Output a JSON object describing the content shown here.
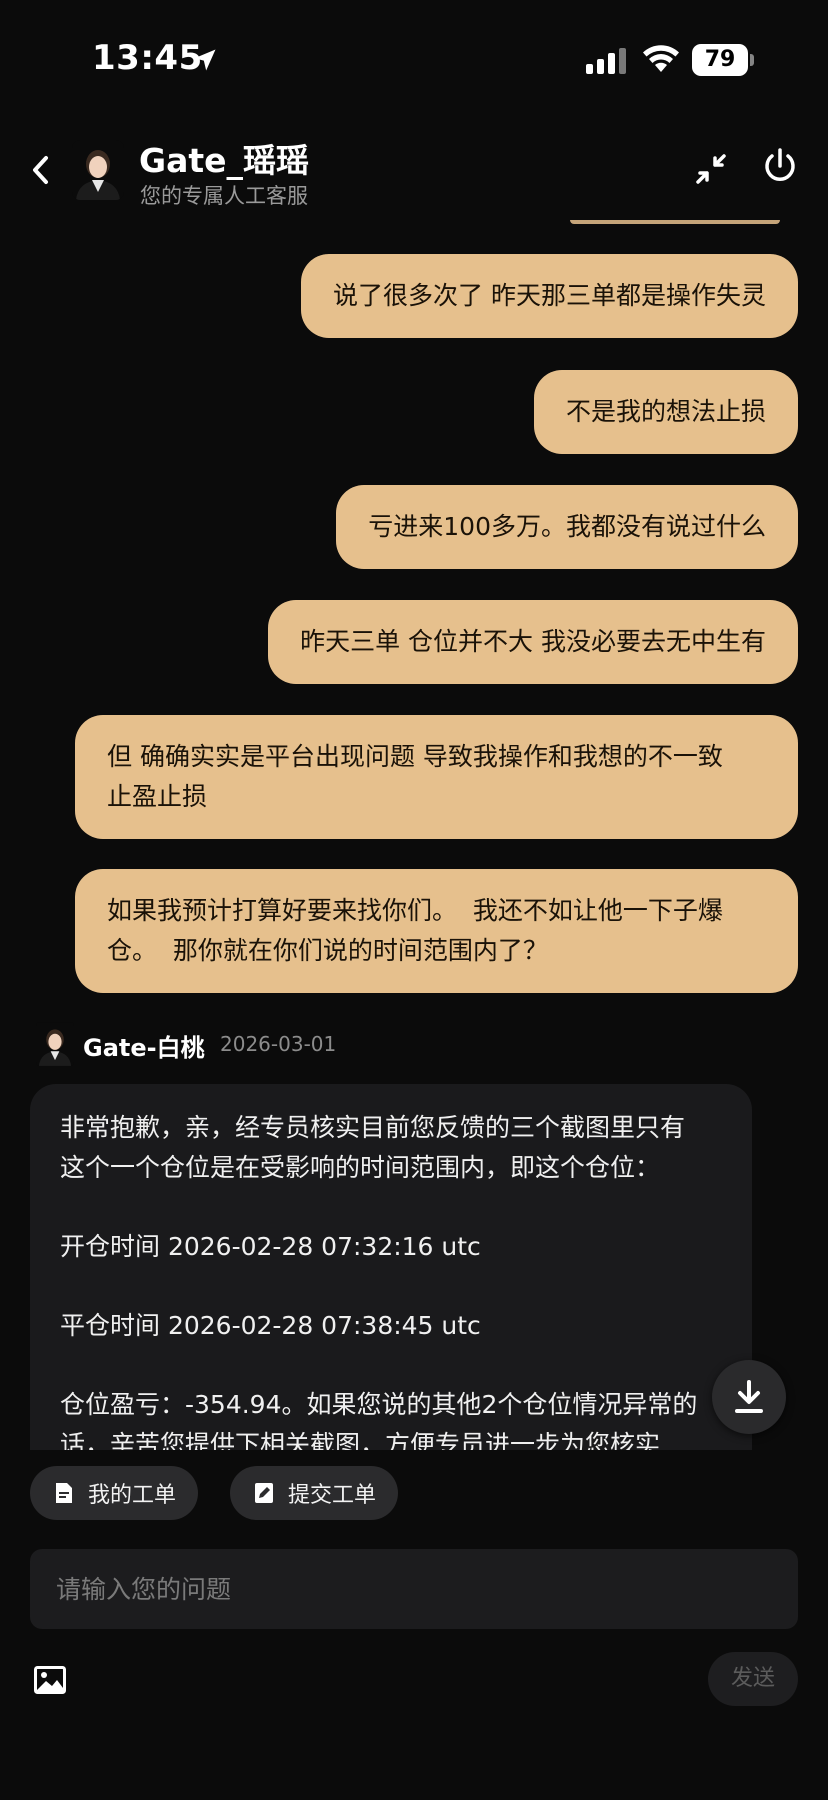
{
  "status_bar": {
    "time": "13:45",
    "battery": "79"
  },
  "header": {
    "agent_name": "Gate_瑶瑶",
    "subtitle": "您的专属人工客服"
  },
  "messages": [
    {
      "from": "user",
      "text": "说了很多次了 昨天那三单都是操作失灵"
    },
    {
      "from": "user",
      "text": "不是我的想法止损"
    },
    {
      "from": "user",
      "text": "亏进来100多万。我都没有说过什么"
    },
    {
      "from": "user",
      "text": "昨天三单 仓位并不大 我没必要去无中生有"
    },
    {
      "from": "user",
      "text": "但 确确实实是平台出现问题 导致我操作和我想的不一致\n止盈止损"
    },
    {
      "from": "user",
      "text": "如果我预计打算好要来找你们。  我还不如让他一下子爆\n仓。  那你就在你们说的时间范围内了？"
    }
  ],
  "agent_reply": {
    "name": "Gate-白桃",
    "date": "2026-03-01",
    "paragraphs": [
      "非常抱歉，亲，经专员核实目前您反馈的三个截图里只有\n这个一个仓位是在受影响的时间范围内，即这个仓位：",
      "开仓时间 2026-02-28 07:32:16 utc",
      "平仓时间 2026-02-28 07:38:45 utc",
      "仓位盈亏：-354.94。如果您说的其他2个仓位情况异常的\n话，辛苦您提供下相关截图，方便专员进一步为您核实"
    ]
  },
  "actions": {
    "my_tickets": "我的工单",
    "submit_ticket": "提交工单"
  },
  "input": {
    "placeholder": "请输入您的问题",
    "send_label": "发送"
  },
  "colors": {
    "user_bubble": "#e6c08d",
    "background": "#0b0b0b",
    "agent_bubble": "#1a1a1c"
  }
}
